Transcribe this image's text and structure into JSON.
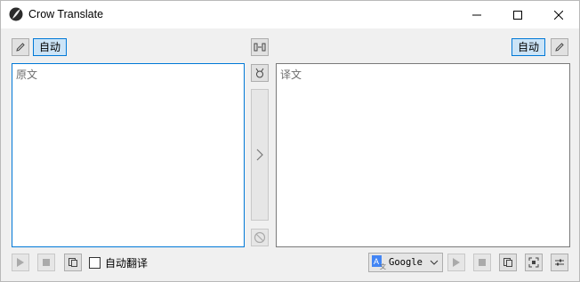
{
  "window": {
    "title": "Crow Translate",
    "icon": "crow-app-icon"
  },
  "source": {
    "language_button": "自动",
    "placeholder": "原文",
    "auto_translate_label": "自动翻译",
    "auto_translate_checked": false
  },
  "translation": {
    "language_button": "自动",
    "placeholder": "译文",
    "engine": "Google"
  },
  "colors": {
    "accent": "#0078d7",
    "selected_bg": "#cce4f7",
    "window_bg": "#f0f0f0",
    "google_blue": "#4285f4"
  }
}
